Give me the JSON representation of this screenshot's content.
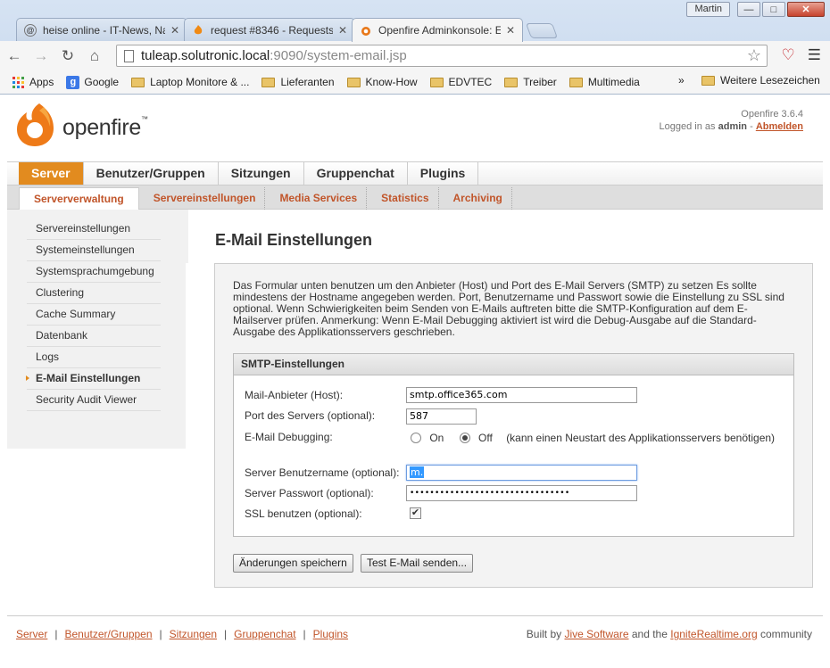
{
  "browser": {
    "user_badge": "Martin",
    "tabs": [
      {
        "title": "heise online - IT-News, Na",
        "icon": "heise-icon"
      },
      {
        "title": "request #8346 - Requests",
        "icon": "fire-icon"
      },
      {
        "title": "Openfire Adminkonsole: E",
        "icon": "openfire-icon"
      }
    ],
    "url_host": "tuleap.solutronic.local",
    "url_path": ":9090/system-email.jsp",
    "bookmarks": [
      "Apps",
      "Google",
      "Laptop Monitore & ...",
      "Lieferanten",
      "Know-How",
      "EDVTEC",
      "Treiber",
      "Multimedia"
    ],
    "bookmarks_more": "»",
    "other_bookmarks": "Weitere Lesezeichen"
  },
  "header": {
    "logo_text": "openfire",
    "logo_tm": "™",
    "version": "Openfire 3.6.4",
    "logged_in_prefix": "Logged in as",
    "user": "admin",
    "dash": "-",
    "logout": "Abmelden"
  },
  "main_nav": [
    "Server",
    "Benutzer/Gruppen",
    "Sitzungen",
    "Gruppenchat",
    "Plugins"
  ],
  "sub_nav": [
    "Serververwaltung",
    "Servereinstellungen",
    "Media Services",
    "Statistics",
    "Archiving"
  ],
  "sidebar": [
    "Servereinstellungen",
    "Systemeinstellungen",
    "Systemsprachumgebung",
    "Clustering",
    "Cache Summary",
    "Datenbank",
    "Logs",
    "E-Mail Einstellungen",
    "Security Audit Viewer"
  ],
  "page": {
    "title": "E-Mail Einstellungen",
    "description": "Das Formular unten benutzen um den Anbieter (Host) und Port des E-Mail Servers (SMTP) zu setzen Es sollte mindestens der Hostname angegeben werden. Port, Benutzername und Passwort sowie die Einstellung zu SSL sind optional. Wenn Schwierigkeiten beim Senden von E-Mails auftreten bitte die SMTP-Konfiguration auf dem E-Mailserver prüfen. Anmerkung: Wenn E-Mail Debugging aktiviert ist wird die Debug-Ausgabe auf die Standard-Ausgabe des Applikationsservers geschrieben.",
    "smtp_title": "SMTP-Einstellungen",
    "host_label": "Mail-Anbieter (Host):",
    "host_value": "smtp.office365.com",
    "port_label": "Port des Servers (optional):",
    "port_value": "587",
    "debug_label": "E-Mail Debugging:",
    "debug_on": "On",
    "debug_off": "Off",
    "debug_note": "(kann einen Neustart des Applikationsservers benötigen)",
    "user_label": "Server Benutzername (optional):",
    "user_value": "m.",
    "pass_label": "Server Passwort (optional):",
    "pass_value": "••••••••••••••••••••••••••••••••",
    "ssl_label": "SSL benutzen (optional):",
    "save_button": "Änderungen speichern",
    "test_button": "Test E-Mail senden..."
  },
  "footer": {
    "links": [
      "Server",
      "Benutzer/Gruppen",
      "Sitzungen",
      "Gruppenchat",
      "Plugins"
    ],
    "separator": "|",
    "credit_prefix": "Built by",
    "credit_jive": "Jive Software",
    "credit_mid": "and the",
    "credit_ignite": "IgniteRealtime.org",
    "credit_suffix": "community"
  },
  "colors": {
    "accent": "#e28b1f",
    "link": "#c1552a"
  }
}
